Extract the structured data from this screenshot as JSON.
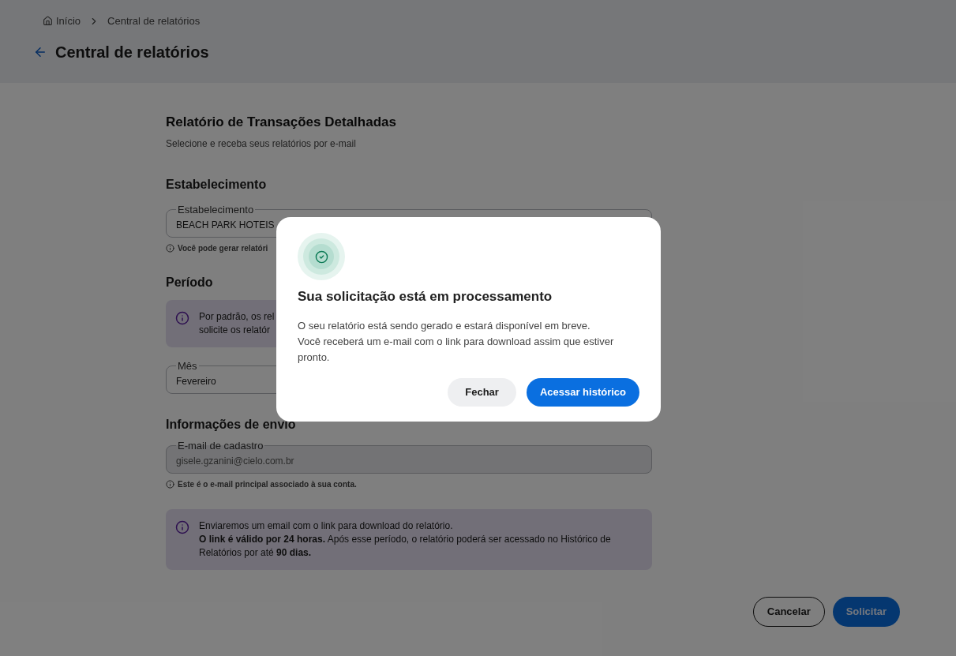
{
  "breadcrumb": [
    {
      "label": "Início",
      "kind": "home"
    },
    {
      "label": "Central de relatórios",
      "kind": "page"
    }
  ],
  "page_title": "Central de relatórios",
  "report": {
    "title": "Relatório de Transações Detalhadas",
    "subtitle": "Selecione e receba seus relatórios por e-mail"
  },
  "establishment": {
    "heading": "Estabelecimento",
    "field": {
      "label": "Estabelecimento",
      "value": "BEACH PARK HOTEIS "
    },
    "helper": "Você pode gerar relatóri"
  },
  "period": {
    "heading": "Período",
    "notice": [
      "Por padrão, os rel",
      "solicite os relatór"
    ],
    "field": {
      "label": "Mês",
      "value": "Fevereiro"
    }
  },
  "delivery": {
    "heading": "Informações de envio",
    "field": {
      "label": "E-mail de cadastro",
      "value": "gisele.gzanini@cielo.com.br",
      "disabled": true
    },
    "helper": "Este é o e-mail principal associado à sua conta.",
    "notice": [
      "Enviaremos um email com o link para download do relatório.",
      "**O link é válido por 24 horas.** Após esse período, o relatório poderá ser acessado no Histórico de Relatórios por até **90 dias.**"
    ]
  },
  "actions": [
    {
      "label": "Cancelar",
      "kind": "secondary"
    },
    {
      "label": "Solicitar",
      "kind": "primary"
    }
  ],
  "dialog": {
    "title": "Sua solicitação está em processamento",
    "message": "O seu relatório está sendo gerado e estará disponível em breve. Você receberá um e-mail com o link para download assim que estiver pronto.",
    "buttons": [
      {
        "label": "Fechar",
        "kind": "secondary"
      },
      {
        "label": "Acessar histórico",
        "kind": "primary"
      }
    ]
  }
}
